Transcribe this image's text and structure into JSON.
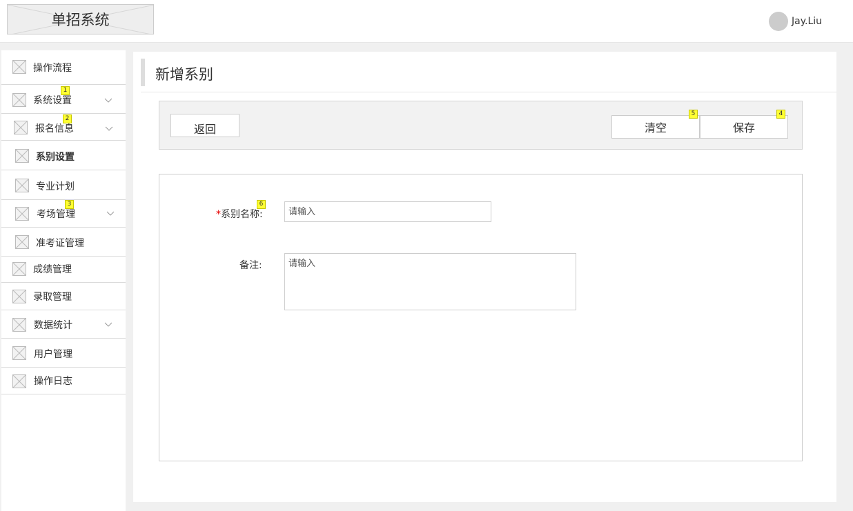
{
  "app": {
    "title": "单招系统"
  },
  "user": {
    "name": "Jay.Liu"
  },
  "sidebar": {
    "items": [
      {
        "label": "操作流程"
      },
      {
        "label": "系统设置",
        "badge": "1"
      },
      {
        "label": "报名信息",
        "badge": "2"
      },
      {
        "label": "系别设置"
      },
      {
        "label": "专业计划"
      },
      {
        "label": "考场管理",
        "badge": "3"
      },
      {
        "label": "准考证管理"
      },
      {
        "label": "成绩管理"
      },
      {
        "label": "录取管理"
      },
      {
        "label": "数据统计"
      },
      {
        "label": "用户管理"
      },
      {
        "label": "操作日志"
      }
    ]
  },
  "page": {
    "title": "新增系别"
  },
  "toolbar": {
    "back_label": "返回",
    "clear_label": "清空",
    "clear_badge": "5",
    "save_label": "保存",
    "save_badge": "4"
  },
  "form": {
    "name": {
      "required_mark": "*",
      "label": "系别名称:",
      "placeholder": "请输入",
      "badge": "6"
    },
    "remark": {
      "label": "备注:",
      "placeholder": "请输入"
    }
  },
  "icons": {
    "placeholder": "image-placeholder-icon",
    "expand": "chevron-down-icon"
  },
  "colors": {
    "badge": "#ffff33",
    "required": "#e60000",
    "toolbar_bg": "#f2f2f2"
  }
}
